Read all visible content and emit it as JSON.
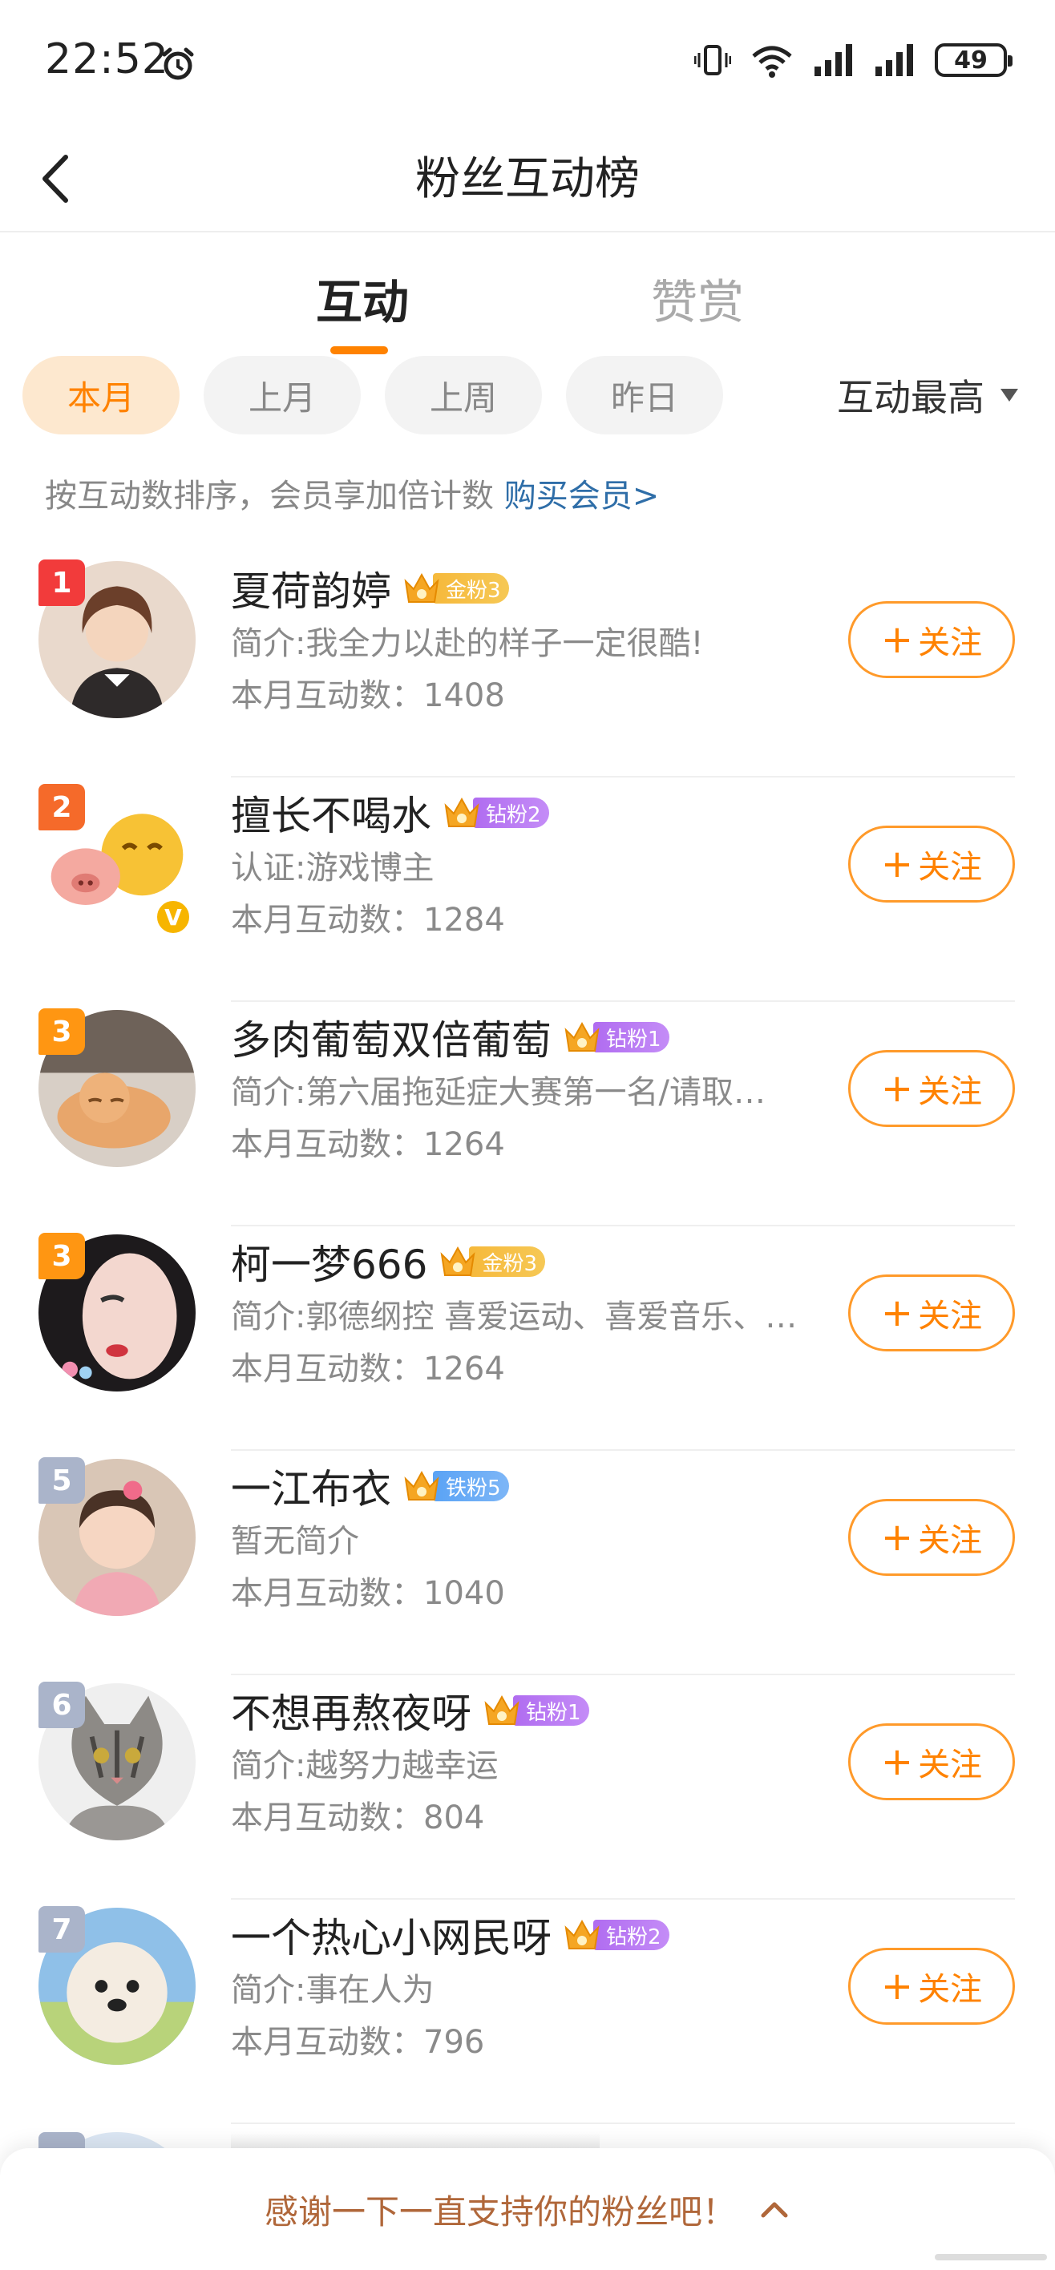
{
  "status_bar": {
    "time": "22:52",
    "battery": "49"
  },
  "header": {
    "title": "粉丝互动榜"
  },
  "tabs": [
    {
      "label": "互动",
      "active": true
    },
    {
      "label": "赞赏",
      "active": false
    }
  ],
  "filters": [
    {
      "label": "本月",
      "active": true
    },
    {
      "label": "上月",
      "active": false
    },
    {
      "label": "上周",
      "active": false
    },
    {
      "label": "昨日",
      "active": false
    }
  ],
  "sort": {
    "label": "互动最高"
  },
  "hint": {
    "text": "按互动数排序，会员享加倍计数 ",
    "link": "购买会员>"
  },
  "fans": [
    {
      "rank": "1",
      "name": "夏荷韵婷",
      "badge": "金粉3",
      "badge_type": "gold",
      "desc": "简介:我全力以赴的样子一定很酷!",
      "count": "本月互动数：1408",
      "follow": "关注"
    },
    {
      "rank": "2",
      "name": "擅长不喝水",
      "badge": "钻粉2",
      "badge_type": "diamond",
      "desc": "认证:游戏博主",
      "count": "本月互动数：1284",
      "follow": "关注"
    },
    {
      "rank": "3",
      "name": "多肉葡萄双倍葡萄",
      "badge": "钻粉1",
      "badge_type": "diamond",
      "desc": "简介:第六届拖延症大赛第一名/请取…",
      "count": "本月互动数：1264",
      "follow": "关注"
    },
    {
      "rank": "3",
      "name": "柯一梦666",
      "badge": "金粉3",
      "badge_type": "gold",
      "desc": "简介:郭德纲控 喜爱运动、喜爱音乐、…",
      "count": "本月互动数：1264",
      "follow": "关注"
    },
    {
      "rank": "5",
      "name": "一江布衣",
      "badge": "铁粉5",
      "badge_type": "iron",
      "desc": "暂无简介",
      "count": "本月互动数：1040",
      "follow": "关注"
    },
    {
      "rank": "6",
      "name": "不想再熬夜呀",
      "badge": "钻粉1",
      "badge_type": "diamond",
      "desc": "简介:越努力越幸运",
      "count": "本月互动数：804",
      "follow": "关注"
    },
    {
      "rank": "7",
      "name": "一个热心小网民呀",
      "badge": "钻粉2",
      "badge_type": "diamond",
      "desc": "简介:事在人为",
      "count": "本月互动数：796",
      "follow": "关注"
    }
  ],
  "bottom_bar": {
    "text": "感谢一下一直支持你的粉丝吧！"
  },
  "colors": {
    "accent": "#ff8200",
    "link": "#2f6ea8",
    "gold": "#f6b93b",
    "diamond": "#b06cf0",
    "iron": "#5aa3f5"
  }
}
